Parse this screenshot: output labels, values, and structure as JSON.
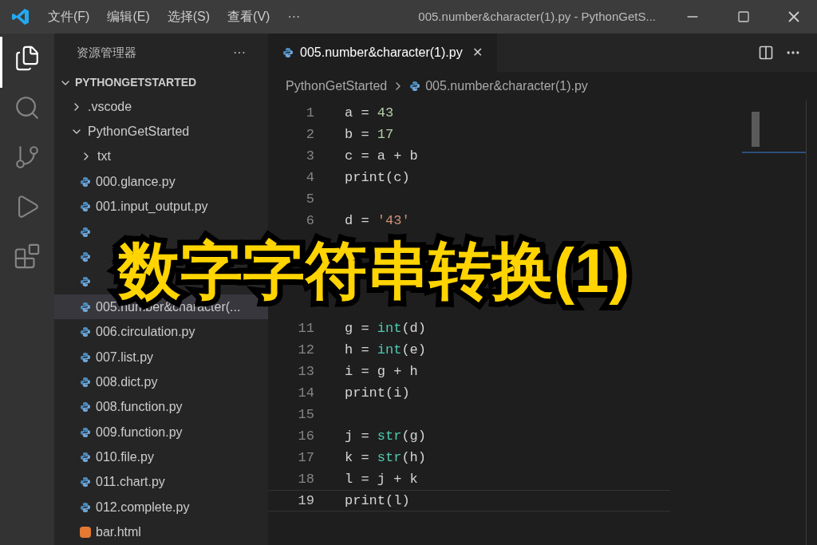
{
  "title_bar": {
    "menus": [
      "文件(F)",
      "编辑(E)",
      "选择(S)",
      "查看(V)"
    ],
    "more": "···",
    "title": "005.number&character(1).py - PythonGetS..."
  },
  "sidebar": {
    "title": "资源管理器",
    "more": "···",
    "root": {
      "label": "PYTHONGETSTARTED",
      "expanded": true,
      "children": [
        {
          "label": ".vscode",
          "kind": "folder",
          "expanded": false
        },
        {
          "label": "PythonGetStarted",
          "kind": "folder",
          "expanded": true,
          "children": [
            {
              "label": "txt",
              "kind": "folder",
              "expanded": false
            },
            {
              "label": "000.glance.py",
              "kind": "python",
              "selected": false
            },
            {
              "label": "001.input_output.py",
              "kind": "python",
              "selected": false
            },
            {
              "kind": "python",
              "selected": false
            },
            {
              "kind": "python",
              "selected": false
            },
            {
              "kind": "python",
              "selected": false
            },
            {
              "label": "005.number&character(...",
              "kind": "python",
              "selected": true
            },
            {
              "label": "006.circulation.py",
              "kind": "python",
              "selected": false
            },
            {
              "label": "007.list.py",
              "kind": "python",
              "selected": false
            },
            {
              "label": "008.dict.py",
              "kind": "python",
              "selected": false
            },
            {
              "label": "008.function.py",
              "kind": "python",
              "selected": false
            },
            {
              "label": "009.function.py",
              "kind": "python",
              "selected": false
            },
            {
              "label": "010.file.py",
              "kind": "python",
              "selected": false
            },
            {
              "label": "011.chart.py",
              "kind": "python",
              "selected": false
            },
            {
              "label": "012.complete.py",
              "kind": "python",
              "selected": false
            },
            {
              "label": "bar.html",
              "kind": "html",
              "selected": false
            }
          ]
        }
      ]
    }
  },
  "editor": {
    "tab": {
      "label": "005.number&character(1).py",
      "close": "✕",
      "selected": true
    },
    "breadcrumb": [
      "PythonGetStarted",
      "005.number&character(1).py"
    ],
    "lines": [
      {
        "n": "1",
        "code": [
          {
            "t": "a = ",
            "kind": "plain"
          },
          {
            "t": "43",
            "kind": "number"
          }
        ]
      },
      {
        "n": "2",
        "code": [
          {
            "t": "b = ",
            "kind": "plain"
          },
          {
            "t": "17",
            "kind": "number"
          }
        ]
      },
      {
        "n": "3",
        "code": [
          {
            "t": "c = a + b",
            "kind": "plain"
          }
        ]
      },
      {
        "n": "4",
        "code": [
          {
            "t": "print(c)",
            "kind": "plain"
          }
        ]
      },
      {
        "n": "5"
      },
      {
        "n": "6",
        "code": [
          {
            "t": "d = ",
            "kind": "plain"
          },
          {
            "t": "'43'",
            "kind": "string"
          }
        ]
      },
      {
        "n": "11",
        "after_gap": true,
        "code": [
          {
            "t": "g = ",
            "kind": "plain"
          },
          {
            "t": "int",
            "kind": "builtin"
          },
          {
            "t": "(d)",
            "kind": "plain"
          }
        ]
      },
      {
        "n": "12",
        "code": [
          {
            "t": "h = ",
            "kind": "plain"
          },
          {
            "t": "int",
            "kind": "builtin"
          },
          {
            "t": "(e)",
            "kind": "plain"
          }
        ]
      },
      {
        "n": "13",
        "code": [
          {
            "t": "i = g + h",
            "kind": "plain"
          }
        ]
      },
      {
        "n": "14",
        "code": [
          {
            "t": "print(i)",
            "kind": "plain"
          }
        ]
      },
      {
        "n": "15"
      },
      {
        "n": "16",
        "code": [
          {
            "t": "j = ",
            "kind": "plain"
          },
          {
            "t": "str",
            "kind": "builtin"
          },
          {
            "t": "(g)",
            "kind": "plain"
          }
        ]
      },
      {
        "n": "17",
        "code": [
          {
            "t": "k = ",
            "kind": "plain"
          },
          {
            "t": "str",
            "kind": "builtin"
          },
          {
            "t": "(h)",
            "kind": "plain"
          }
        ]
      },
      {
        "n": "18",
        "code": [
          {
            "t": "l = j + k",
            "kind": "plain"
          }
        ]
      },
      {
        "n": "19",
        "code": [
          {
            "t": "print(l)",
            "kind": "plain"
          }
        ],
        "current": true
      }
    ]
  },
  "caption": "数字字符串转换(1)"
}
